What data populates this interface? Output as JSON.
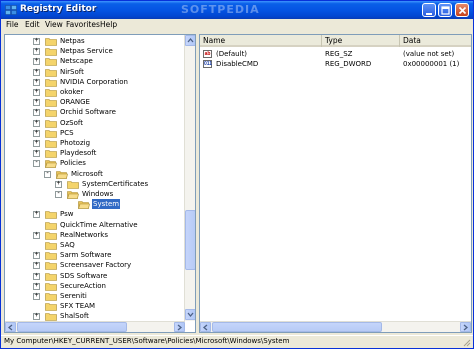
{
  "window": {
    "title": "Registry Editor",
    "watermark": "SOFTPEDIA"
  },
  "menu": [
    "File",
    "Edit",
    "View",
    "Favorites",
    "Help"
  ],
  "tree": [
    {
      "label": "Netpas",
      "level": 0,
      "expander": "+",
      "selected": false
    },
    {
      "label": "Netpas Service",
      "level": 0,
      "expander": "+",
      "selected": false
    },
    {
      "label": "Netscape",
      "level": 0,
      "expander": "+",
      "selected": false
    },
    {
      "label": "NirSoft",
      "level": 0,
      "expander": "+",
      "selected": false
    },
    {
      "label": "NVIDIA Corporation",
      "level": 0,
      "expander": "+",
      "selected": false
    },
    {
      "label": "okoker",
      "level": 0,
      "expander": "+",
      "selected": false
    },
    {
      "label": "ORANGE",
      "level": 0,
      "expander": "+",
      "selected": false
    },
    {
      "label": "Orchid Software",
      "level": 0,
      "expander": "+",
      "selected": false
    },
    {
      "label": "OzSoft",
      "level": 0,
      "expander": "+",
      "selected": false
    },
    {
      "label": "PCS",
      "level": 0,
      "expander": "+",
      "selected": false
    },
    {
      "label": "Photozig",
      "level": 0,
      "expander": "+",
      "selected": false
    },
    {
      "label": "Playdesoft",
      "level": 0,
      "expander": "+",
      "selected": false
    },
    {
      "label": "Policies",
      "level": 0,
      "expander": "-",
      "selected": false
    },
    {
      "label": "Microsoft",
      "level": 1,
      "expander": "-",
      "selected": false
    },
    {
      "label": "SystemCertificates",
      "level": 2,
      "expander": "+",
      "selected": false
    },
    {
      "label": "Windows",
      "level": 2,
      "expander": "-",
      "selected": false
    },
    {
      "label": "System",
      "level": 3,
      "expander": "",
      "selected": true
    },
    {
      "label": "Psw",
      "level": 0,
      "expander": "+",
      "selected": false
    },
    {
      "label": "QuickTime Alternative",
      "level": 0,
      "expander": "",
      "selected": false
    },
    {
      "label": "RealNetworks",
      "level": 0,
      "expander": "+",
      "selected": false
    },
    {
      "label": "SAQ",
      "level": 0,
      "expander": "",
      "selected": false
    },
    {
      "label": "Sarm Software",
      "level": 0,
      "expander": "+",
      "selected": false
    },
    {
      "label": "Screensaver Factory",
      "level": 0,
      "expander": "+",
      "selected": false
    },
    {
      "label": "SDS Software",
      "level": 0,
      "expander": "+",
      "selected": false
    },
    {
      "label": "SecureAction",
      "level": 0,
      "expander": "+",
      "selected": false
    },
    {
      "label": "Sereniti",
      "level": 0,
      "expander": "+",
      "selected": false
    },
    {
      "label": "SFX TEAM",
      "level": 0,
      "expander": "",
      "selected": false
    },
    {
      "label": "ShalSoft",
      "level": 0,
      "expander": "+",
      "selected": false
    }
  ],
  "columns": [
    "Name",
    "Type",
    "Data"
  ],
  "values": [
    {
      "name": "(Default)",
      "type": "REG_SZ",
      "data": "(value not set)",
      "icon": "string-value-icon",
      "icon_text": "ab"
    },
    {
      "name": "DisableCMD",
      "type": "REG_DWORD",
      "data": "0x00000001 (1)",
      "icon": "binary-value-icon",
      "icon_text": "011"
    }
  ],
  "status": "My Computer\\HKEY_CURRENT_USER\\Software\\Policies\\Microsoft\\Windows\\System",
  "colors": {
    "title_blue": "#0554e3",
    "selection": "#316ac5",
    "folder": "#f4d46b"
  }
}
